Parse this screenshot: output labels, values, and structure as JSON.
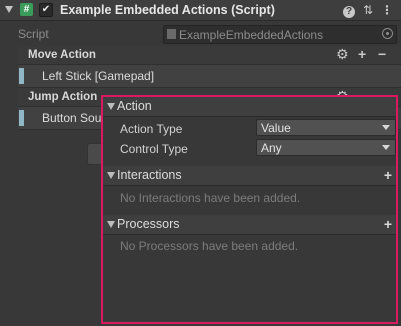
{
  "component": {
    "title": "Example Embedded Actions (Script)",
    "script_icon_glyph": "#",
    "checkbox_glyph": "✔",
    "help_icon": "?",
    "settings_icon": "⇅",
    "menu_icon": "⋮"
  },
  "script_row": {
    "label": "Script",
    "value": "ExampleEmbeddedActions"
  },
  "actions": [
    {
      "label": "Move Action",
      "binding": "Left Stick [Gamepad]"
    },
    {
      "label": "Jump Action",
      "binding": "Button Sou"
    }
  ],
  "action_toolbar": {
    "gear_icon": "⚙",
    "add_icon": "+",
    "remove_icon": "−"
  },
  "popup": {
    "action_section": {
      "title": "Action",
      "rows": [
        {
          "label": "Action Type",
          "value": "Value"
        },
        {
          "label": "Control Type",
          "value": "Any"
        }
      ]
    },
    "interactions_section": {
      "title": "Interactions",
      "add_icon": "+",
      "empty_message": "No Interactions have been added."
    },
    "processors_section": {
      "title": "Processors",
      "add_icon": "+",
      "empty_message": "No Processors have been added."
    }
  }
}
